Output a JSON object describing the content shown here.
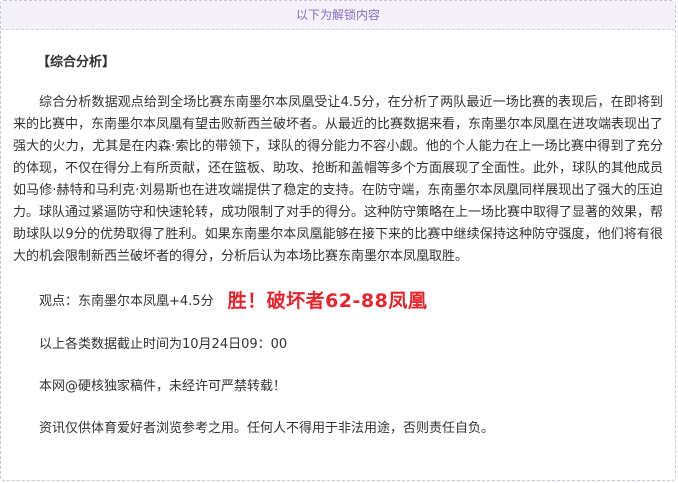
{
  "banner": {
    "text": "以下为解锁内容"
  },
  "article": {
    "section_title": "【综合分析】",
    "paragraph": "综合分析数据观点给到全场比赛东南墨尔本凤凰受让4.5分，在分析了两队最近一场比赛的表现后，在即将到来的比赛中，东南墨尔本凤凰有望击败新西兰破坏者。从最近的比赛数据来看，东南墨尔本凤凰在进攻端表现出了强大的火力，尤其是在内森·索比的带领下，球队的得分能力不容小觑。他的个人能力在上一场比赛中得到了充分的体现，不仅在得分上有所贡献，还在篮板、助攻、抢断和盖帽等多个方面展现了全面性。此外，球队的其他成员如马修·赫特和马利克·刘易斯也在进攻端提供了稳定的支持。在防守端，东南墨尔本凤凰同样展现出了强大的压迫力。球队通过紧逼防守和快速轮转，成功限制了对手的得分。这种防守策略在上一场比赛中取得了显著的效果，帮助球队以9分的优势取得了胜利。如果东南墨尔本凤凰能够在接下来的比赛中继续保持这种防守强度，他们将有很大的机会限制新西兰破坏者的得分，分析后认为本场比赛东南墨尔本凤凰取胜。",
    "view_label": "观点：东南墨尔本凤凰+4.5分",
    "result_text": "胜！破坏者62-88凤凰",
    "deadline_text": "以上各类数据截止时间为10月24日09：00",
    "copyright_text": "本网@硬核独家稿件，未经许可严禁转载！",
    "disclaimer_text": "资讯仅供体育爱好者浏览参考之用。任何人不得用于非法用途，否则责任自负。"
  },
  "colors": {
    "banner_text": "#8a6bc1",
    "banner_bg": "#f4f2f8",
    "result_red": "#e8242b",
    "body_text": "#333333"
  }
}
